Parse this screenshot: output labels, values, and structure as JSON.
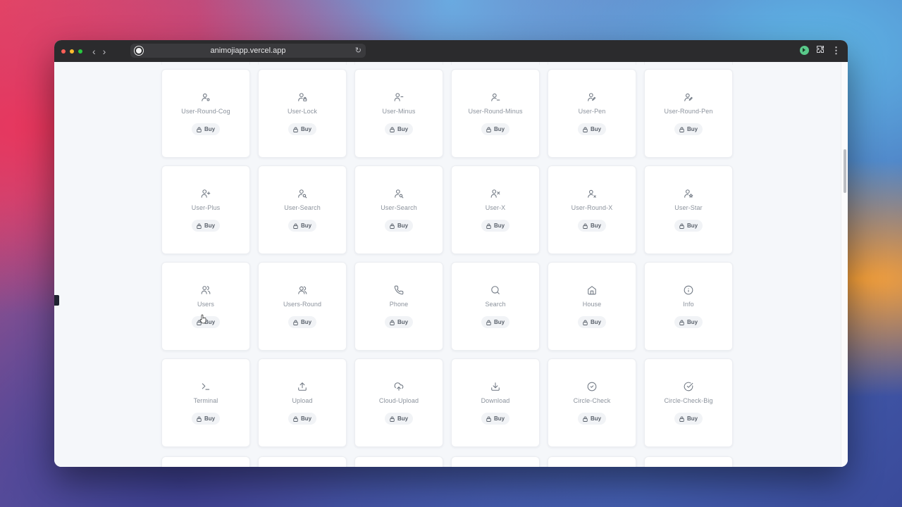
{
  "browser": {
    "url": "animojiapp.vercel.app"
  },
  "buy_label": "Buy",
  "cards": [
    {
      "name": "User-Round-Cog",
      "icon": "user-round-cog-icon"
    },
    {
      "name": "User-Lock",
      "icon": "user-lock-icon"
    },
    {
      "name": "User-Minus",
      "icon": "user-minus-icon"
    },
    {
      "name": "User-Round-Minus",
      "icon": "user-round-minus-icon"
    },
    {
      "name": "User-Pen",
      "icon": "user-pen-icon"
    },
    {
      "name": "User-Round-Pen",
      "icon": "user-round-pen-icon"
    },
    {
      "name": "User-Plus",
      "icon": "user-plus-icon"
    },
    {
      "name": "User-Search",
      "icon": "user-search-icon"
    },
    {
      "name": "User-Search",
      "icon": "user-search-icon"
    },
    {
      "name": "User-X",
      "icon": "user-x-icon"
    },
    {
      "name": "User-Round-X",
      "icon": "user-round-x-icon"
    },
    {
      "name": "User-Star",
      "icon": "user-star-icon"
    },
    {
      "name": "Users",
      "icon": "users-icon"
    },
    {
      "name": "Users-Round",
      "icon": "users-round-icon"
    },
    {
      "name": "Phone",
      "icon": "phone-icon"
    },
    {
      "name": "Search",
      "icon": "search-icon"
    },
    {
      "name": "House",
      "icon": "house-icon"
    },
    {
      "name": "Info",
      "icon": "info-icon"
    },
    {
      "name": "Terminal",
      "icon": "terminal-icon"
    },
    {
      "name": "Upload",
      "icon": "upload-icon"
    },
    {
      "name": "Cloud-Upload",
      "icon": "cloud-upload-icon"
    },
    {
      "name": "Download",
      "icon": "download-icon"
    },
    {
      "name": "Circle-Check",
      "icon": "circle-check-icon"
    },
    {
      "name": "Circle-Check-Big",
      "icon": "circle-check-big-icon"
    }
  ],
  "colors": {
    "card_bg": "#ffffff",
    "page_bg": "#f5f7fa",
    "label": "#8b929c",
    "icon": "#6f7782"
  }
}
